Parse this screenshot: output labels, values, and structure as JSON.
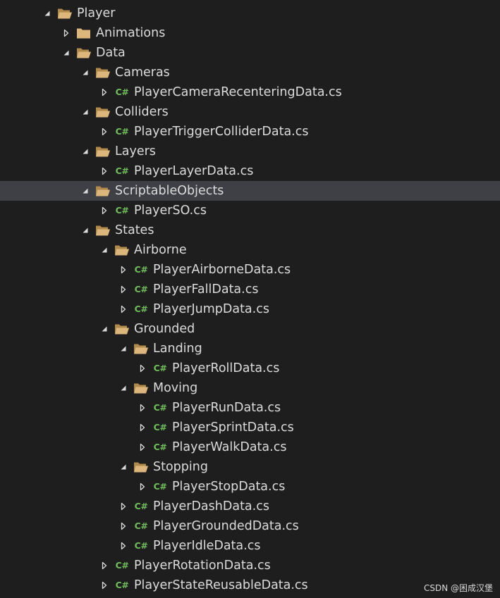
{
  "tree": [
    {
      "label": "Player",
      "kind": "folder",
      "expander": "expanded",
      "depth": 0
    },
    {
      "label": "Animations",
      "kind": "folder",
      "expander": "collapsed",
      "depth": 1
    },
    {
      "label": "Data",
      "kind": "folder",
      "expander": "expanded",
      "depth": 1
    },
    {
      "label": "Cameras",
      "kind": "folder",
      "expander": "expanded",
      "depth": 2
    },
    {
      "label": "PlayerCameraRecenteringData.cs",
      "kind": "cs",
      "expander": "collapsed",
      "depth": 3
    },
    {
      "label": "Colliders",
      "kind": "folder",
      "expander": "expanded",
      "depth": 2
    },
    {
      "label": "PlayerTriggerColliderData.cs",
      "kind": "cs",
      "expander": "collapsed",
      "depth": 3
    },
    {
      "label": "Layers",
      "kind": "folder",
      "expander": "expanded",
      "depth": 2
    },
    {
      "label": "PlayerLayerData.cs",
      "kind": "cs",
      "expander": "collapsed",
      "depth": 3
    },
    {
      "label": "ScriptableObjects",
      "kind": "folder",
      "expander": "expanded",
      "depth": 2,
      "selected": true
    },
    {
      "label": "PlayerSO.cs",
      "kind": "cs",
      "expander": "collapsed",
      "depth": 3
    },
    {
      "label": "States",
      "kind": "folder",
      "expander": "expanded",
      "depth": 2
    },
    {
      "label": "Airborne",
      "kind": "folder",
      "expander": "expanded",
      "depth": 3
    },
    {
      "label": "PlayerAirborneData.cs",
      "kind": "cs",
      "expander": "collapsed",
      "depth": 4
    },
    {
      "label": "PlayerFallData.cs",
      "kind": "cs",
      "expander": "collapsed",
      "depth": 4
    },
    {
      "label": "PlayerJumpData.cs",
      "kind": "cs",
      "expander": "collapsed",
      "depth": 4
    },
    {
      "label": "Grounded",
      "kind": "folder",
      "expander": "expanded",
      "depth": 3
    },
    {
      "label": "Landing",
      "kind": "folder",
      "expander": "expanded",
      "depth": 4
    },
    {
      "label": "PlayerRollData.cs",
      "kind": "cs",
      "expander": "collapsed",
      "depth": 5
    },
    {
      "label": "Moving",
      "kind": "folder",
      "expander": "expanded",
      "depth": 4
    },
    {
      "label": "PlayerRunData.cs",
      "kind": "cs",
      "expander": "collapsed",
      "depth": 5
    },
    {
      "label": "PlayerSprintData.cs",
      "kind": "cs",
      "expander": "collapsed",
      "depth": 5
    },
    {
      "label": "PlayerWalkData.cs",
      "kind": "cs",
      "expander": "collapsed",
      "depth": 5
    },
    {
      "label": "Stopping",
      "kind": "folder",
      "expander": "expanded",
      "depth": 4
    },
    {
      "label": "PlayerStopData.cs",
      "kind": "cs",
      "expander": "collapsed",
      "depth": 5
    },
    {
      "label": "PlayerDashData.cs",
      "kind": "cs",
      "expander": "collapsed",
      "depth": 4
    },
    {
      "label": "PlayerGroundedData.cs",
      "kind": "cs",
      "expander": "collapsed",
      "depth": 4
    },
    {
      "label": "PlayerIdleData.cs",
      "kind": "cs",
      "expander": "collapsed",
      "depth": 4
    },
    {
      "label": "PlayerRotationData.cs",
      "kind": "cs",
      "expander": "collapsed",
      "depth": 3
    },
    {
      "label": "PlayerStateReusableData.cs",
      "kind": "cs",
      "expander": "collapsed",
      "depth": 3
    }
  ],
  "cs_icon_text": "C#",
  "watermark": "CSDN @困成汉堡",
  "colors": {
    "background": "#1e1e1e",
    "selection": "#3f3f46",
    "folder": "#dcb67a",
    "folder_dark": "#b08a4a",
    "cs_icon": "#6fbf5a",
    "text": "#dcdcdc",
    "expander": "#dcdcdc"
  }
}
